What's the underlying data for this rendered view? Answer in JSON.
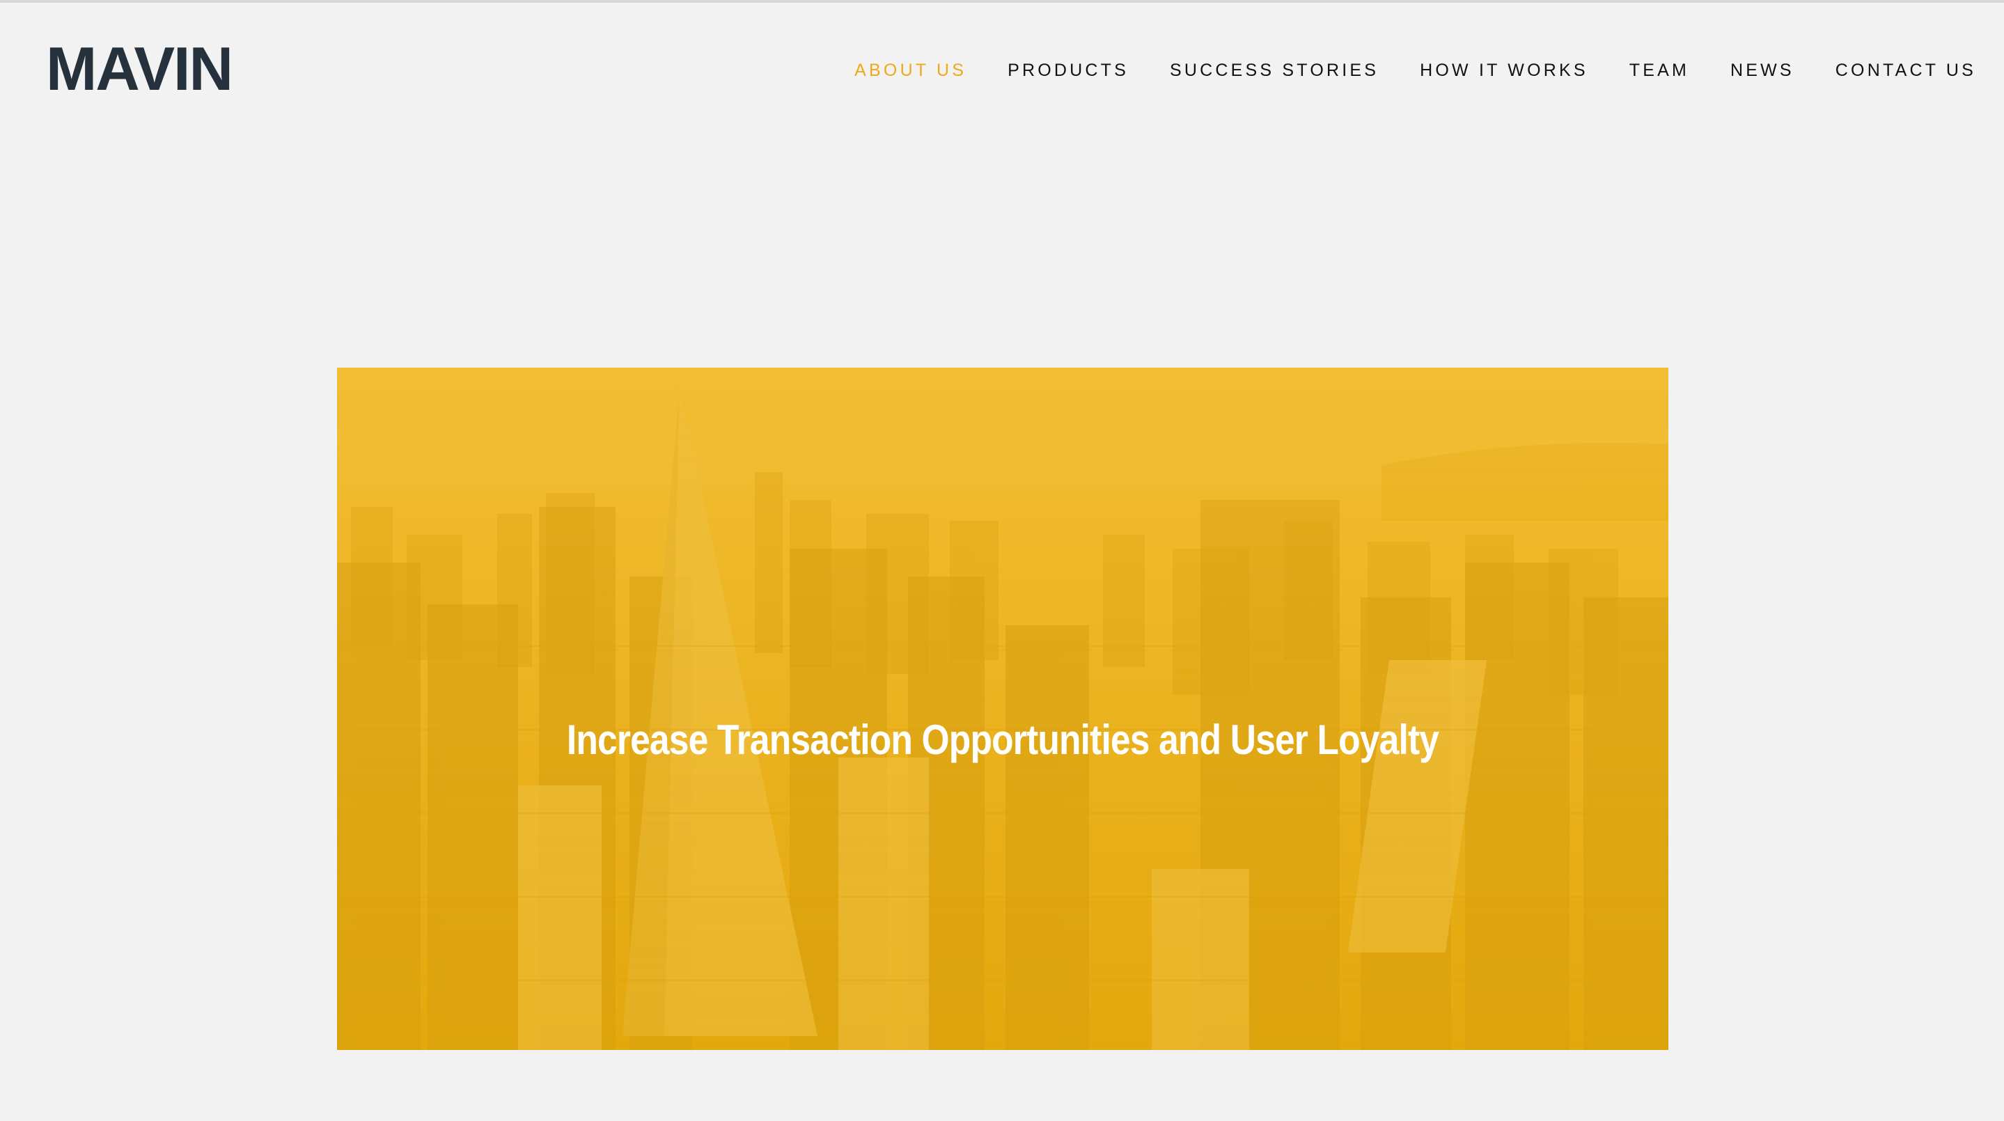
{
  "brand": {
    "logo_text": "MAVIN",
    "logo_color": "#25313c"
  },
  "nav": {
    "items": [
      {
        "label": "ABOUT US",
        "active": true
      },
      {
        "label": "PRODUCTS",
        "active": false
      },
      {
        "label": "SUCCESS STORIES",
        "active": false
      },
      {
        "label": "HOW IT WORKS",
        "active": false
      },
      {
        "label": "TEAM",
        "active": false
      },
      {
        "label": "NEWS",
        "active": false
      },
      {
        "label": "CONTACT US",
        "active": false
      }
    ],
    "active_color": "#f0a818",
    "text_color": "#111111"
  },
  "hero": {
    "title": "Increase Transaction Opportunities and User Loyalty",
    "overlay_color": "#eab21a",
    "image_subject": "aerial city skyline"
  },
  "colors": {
    "page_background": "#f2f2f2"
  }
}
